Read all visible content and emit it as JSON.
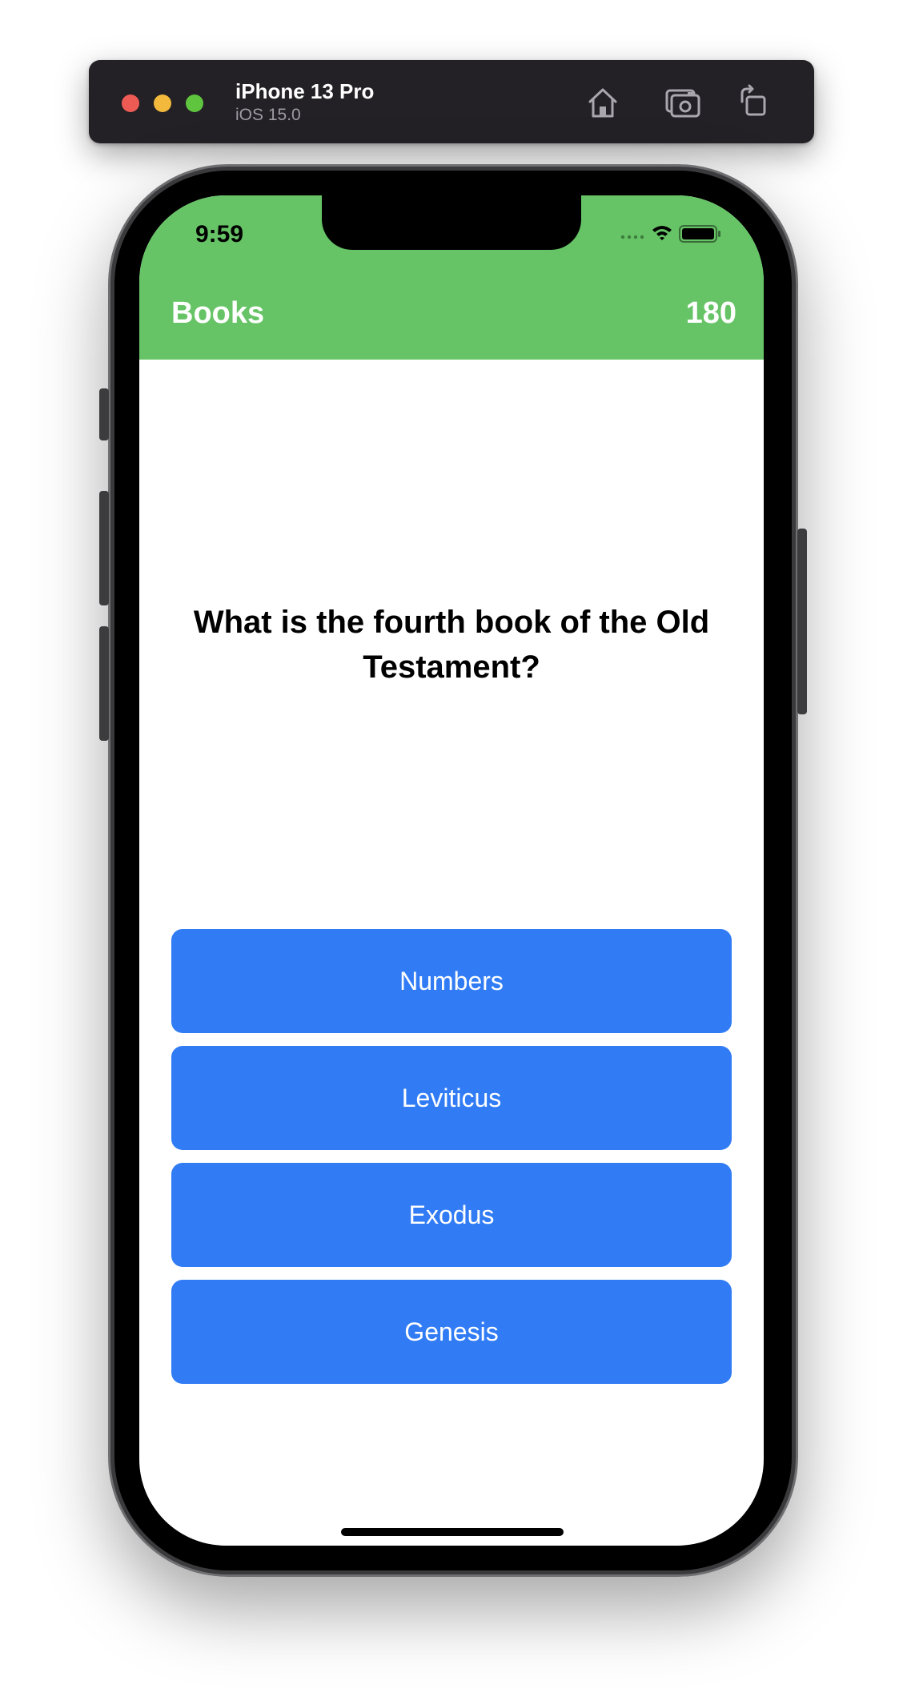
{
  "simulator": {
    "device_name": "iPhone 13 Pro",
    "os_version": "iOS 15.0",
    "icons": [
      "home-icon",
      "screenshot-icon",
      "rotate-icon"
    ]
  },
  "status_bar": {
    "time": "9:59"
  },
  "nav": {
    "title": "Books",
    "score": "180"
  },
  "question": {
    "text": "What is the fourth book of the Old Testament?"
  },
  "answers": [
    {
      "label": "Numbers"
    },
    {
      "label": "Leviticus"
    },
    {
      "label": "Exodus"
    },
    {
      "label": "Genesis"
    }
  ],
  "colors": {
    "header_green": "#66c466",
    "answer_blue": "#317cf5",
    "simulator_bar": "#232126"
  }
}
